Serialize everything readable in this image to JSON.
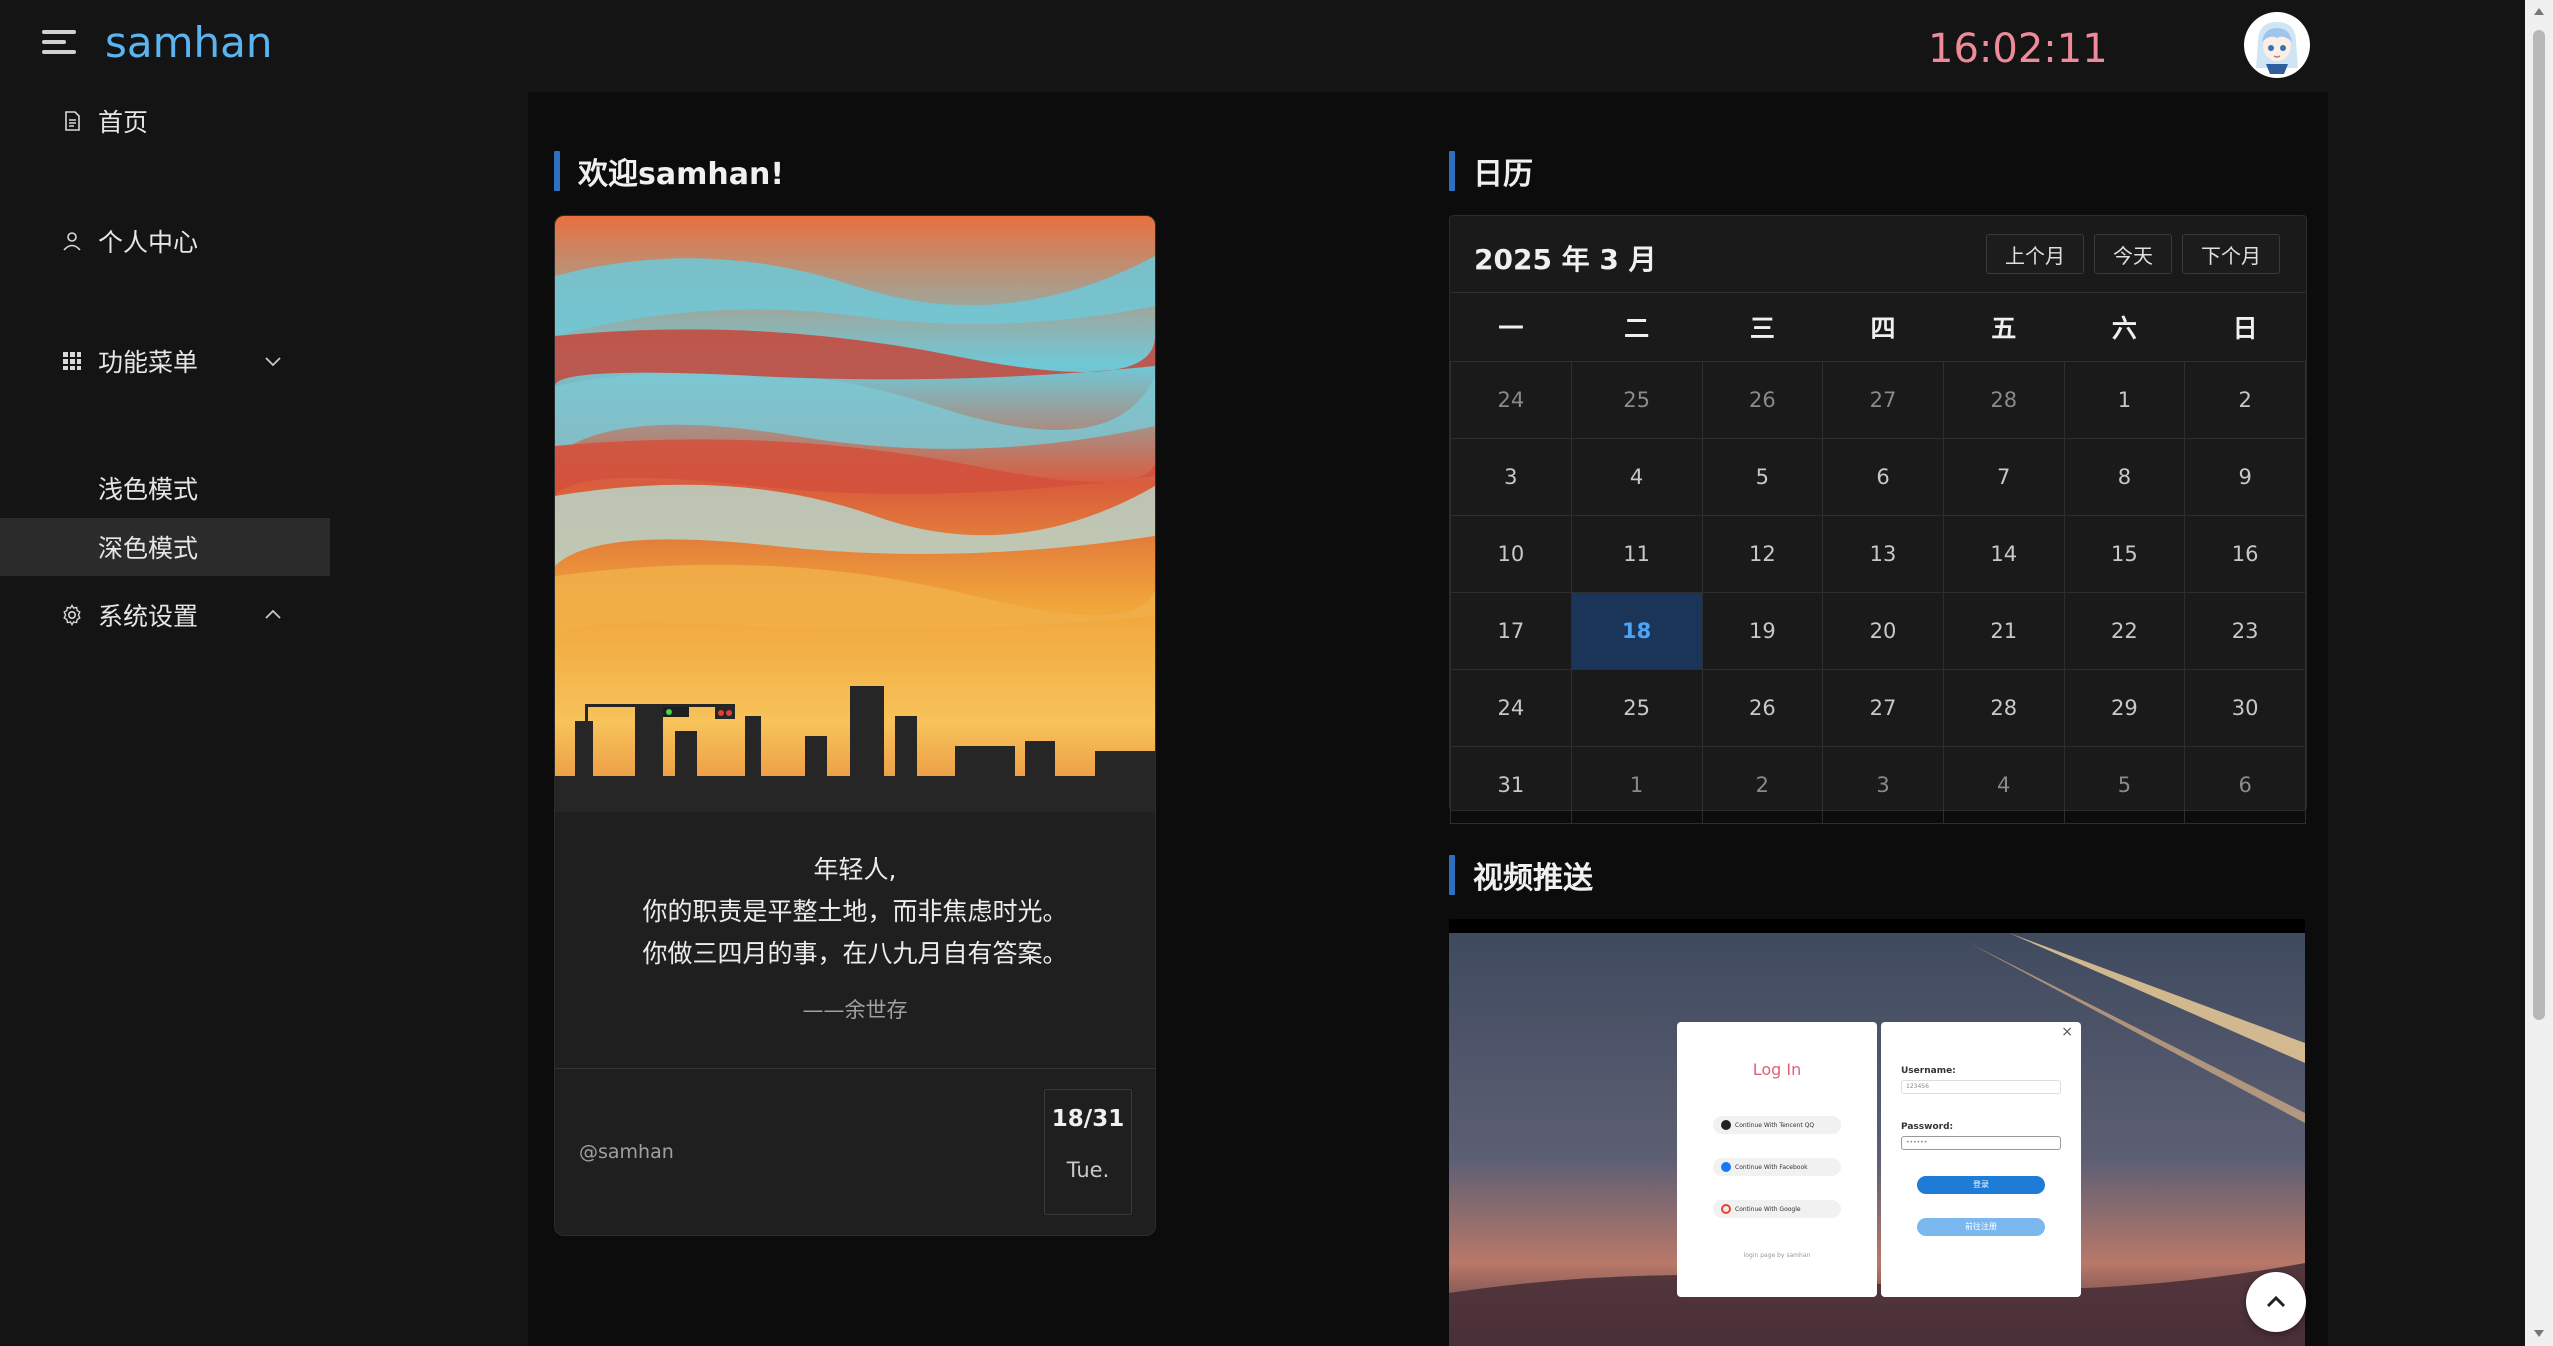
{
  "header": {
    "logo": "samhan",
    "clock": "16:02:11",
    "avatar_icon": "anime-avatar-icon"
  },
  "sidebar": {
    "items": [
      {
        "label": "首页",
        "icon": "document-icon"
      },
      {
        "label": "个人中心",
        "icon": "user-icon"
      },
      {
        "label": "功能菜单",
        "icon": "grid-icon",
        "expanded": true
      },
      {
        "label": "系统设置",
        "icon": "gear-icon",
        "expanded": false
      }
    ],
    "sub_items": [
      {
        "label": "浅色模式",
        "active": false
      },
      {
        "label": "深色模式",
        "active": true
      }
    ]
  },
  "welcome": {
    "title": "欢迎samhan!",
    "quote_lines": [
      "年轻人,",
      "你的职责是平整土地，而非焦虑时光。",
      "你做三四月的事，在八九月自有答案。"
    ],
    "author": "——余世存",
    "handle": "@samhan",
    "date": "18/31",
    "weekday": "Tue."
  },
  "calendar": {
    "title": "日历",
    "month_label": "2025 年 3 月",
    "buttons": {
      "prev": "上个月",
      "today": "今天",
      "next": "下个月"
    },
    "weekdays": [
      "一",
      "二",
      "三",
      "四",
      "五",
      "六",
      "日"
    ],
    "weeks": [
      [
        "24",
        "25",
        "26",
        "27",
        "28",
        "1",
        "2"
      ],
      [
        "3",
        "4",
        "5",
        "6",
        "7",
        "8",
        "9"
      ],
      [
        "10",
        "11",
        "12",
        "13",
        "14",
        "15",
        "16"
      ],
      [
        "17",
        "18",
        "19",
        "20",
        "21",
        "22",
        "23"
      ],
      [
        "24",
        "25",
        "26",
        "27",
        "28",
        "29",
        "30"
      ],
      [
        "31",
        "1",
        "2",
        "3",
        "4",
        "5",
        "6"
      ]
    ],
    "today": "18"
  },
  "video": {
    "title": "视频推送",
    "login_title": "Log In",
    "username_label": "Username:",
    "username_value": "123456",
    "password_label": "Password:",
    "password_value": "••••••",
    "social": [
      "Continue With Tencent QQ",
      "Continue With Facebook",
      "Continue With Google"
    ],
    "login_btn": "登录",
    "register_btn": "前往注册",
    "footer": "login page by samhan",
    "close": "×"
  },
  "colors": {
    "accent": "#5bb4f0",
    "clock": "#ee8a9a",
    "today_bg": "#1b3558",
    "section_bar": "#2f6fbf"
  }
}
